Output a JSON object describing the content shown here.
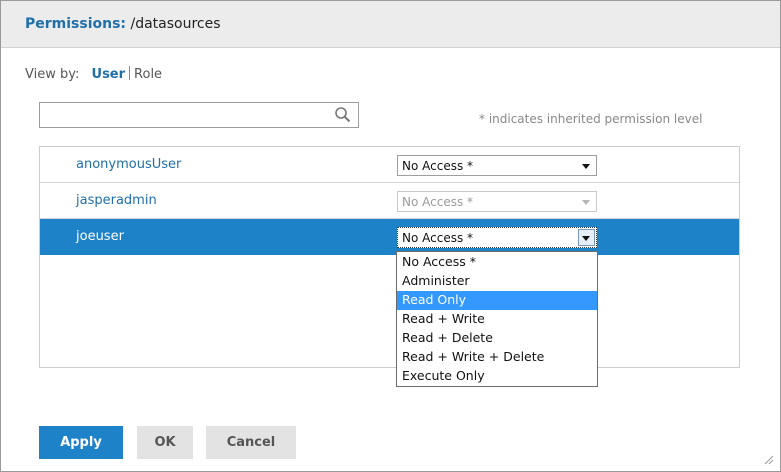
{
  "dialog": {
    "title_label": "Permissions:",
    "title_path": "/datasources"
  },
  "view_by": {
    "label": "View by:",
    "options": [
      "User",
      "Role"
    ],
    "selected": "User"
  },
  "search": {
    "value": "",
    "placeholder": ""
  },
  "hint": "* indicates inherited permission level",
  "users": [
    {
      "name": "anonymousUser",
      "permission": "No Access *",
      "state": "enabled"
    },
    {
      "name": "jasperadmin",
      "permission": "No Access *",
      "state": "disabled"
    },
    {
      "name": "joeuser",
      "permission": "No Access *",
      "state": "open-selected"
    }
  ],
  "dropdown": {
    "options": [
      "No Access *",
      "Administer",
      "Read Only",
      "Read + Write",
      "Read + Delete",
      "Read + Write + Delete",
      "Execute Only"
    ],
    "highlighted": "Read Only"
  },
  "buttons": {
    "apply": "Apply",
    "ok": "OK",
    "cancel": "Cancel"
  },
  "colors": {
    "accent": "#1e82c8",
    "link": "#1f6faa",
    "highlight": "#3399ff"
  }
}
